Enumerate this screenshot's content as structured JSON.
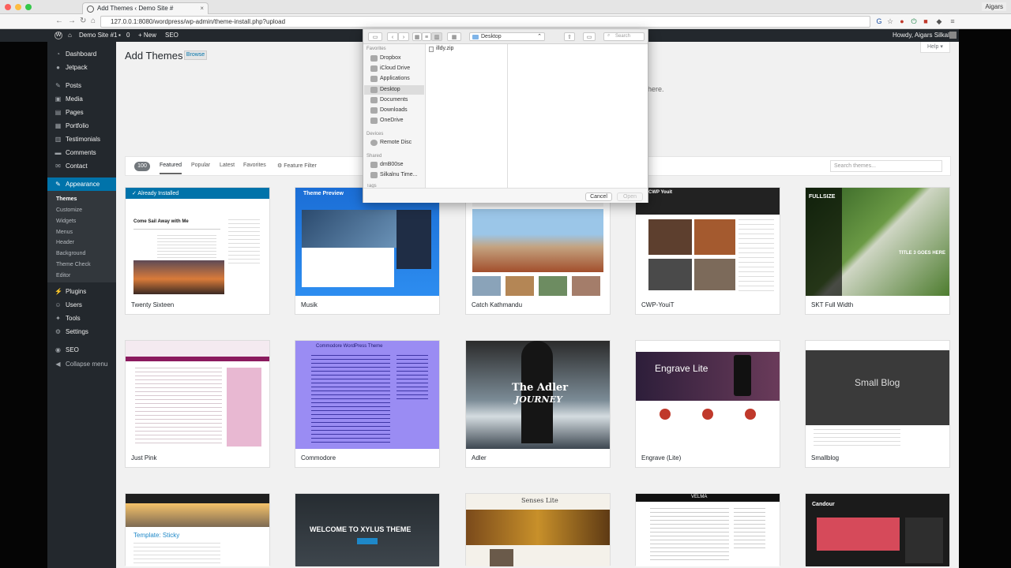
{
  "browser": {
    "tab_title": "Add Themes ‹ Demo Site #",
    "tab_close": "×",
    "profile": "Aigars",
    "url": "127.0.0.1:8080/wordpress/wp-admin/theme-install.php?upload",
    "back_icon": "←",
    "forward_icon": "→",
    "reload_icon": "↻",
    "home_icon": "⌂",
    "star_icon": "☆",
    "menu_icon": "≡"
  },
  "adminbar": {
    "wp_logo": "W",
    "site_name": "Demo Site #1",
    "comments_count": "0",
    "new_label": "+ New",
    "seo_label": "SEO",
    "greeting": "Howdy, Aigars Silkalns"
  },
  "sidebar": {
    "items": [
      {
        "label": "Dashboard"
      },
      {
        "label": "Jetpack"
      },
      {
        "label": "Posts"
      },
      {
        "label": "Media"
      },
      {
        "label": "Pages"
      },
      {
        "label": "Portfolio"
      },
      {
        "label": "Testimonials"
      },
      {
        "label": "Comments"
      },
      {
        "label": "Contact"
      },
      {
        "label": "Appearance"
      }
    ],
    "submenu": [
      "Themes",
      "Customize",
      "Widgets",
      "Menus",
      "Header",
      "Background",
      "Theme Check",
      "Editor"
    ],
    "lower": [
      {
        "label": "Plugins"
      },
      {
        "label": "Users"
      },
      {
        "label": "Tools"
      },
      {
        "label": "Settings"
      },
      {
        "label": "SEO"
      },
      {
        "label": "Collapse menu"
      }
    ]
  },
  "page": {
    "title": "Add Themes",
    "browse_label": "Browse",
    "help_label": "Help ▾",
    "upload_hint_tail": "here."
  },
  "filters": {
    "count": "100",
    "tabs": [
      "Featured",
      "Popular",
      "Latest",
      "Favorites"
    ],
    "feature_filter": "Feature Filter",
    "search_placeholder": "Search themes..."
  },
  "themes": [
    {
      "name": "Twenty Sixteen",
      "installed_label": "✓  Already Installed"
    },
    {
      "name": "Musik"
    },
    {
      "name": "Catch Kathmandu"
    },
    {
      "name": "CWP-YouiT"
    },
    {
      "name": "SKT Full Width"
    },
    {
      "name": "Just Pink"
    },
    {
      "name": "Commodore"
    },
    {
      "name": "Adler"
    },
    {
      "name": "Engrave (Lite)"
    },
    {
      "name": "Smallblog"
    },
    {
      "name": "",
      "shot_text": "Template: Sticky"
    },
    {
      "name": "",
      "shot_text": "WELCOME TO XYLUS THEME"
    },
    {
      "name": "",
      "shot_text": "Senses Lite"
    },
    {
      "name": "",
      "shot_text": "VELMA"
    },
    {
      "name": "",
      "shot_text": "Candour"
    }
  ],
  "shot_texts": {
    "twenty_sixteen": "Come Sail Away with Me",
    "musik": "Theme Preview",
    "adler": "The Adler",
    "adler_sub": "JOURNEY",
    "engrave": "Engrave Lite",
    "smallblog": "Small Blog",
    "skt": "TITLE 3 GOES HERE",
    "skt_logo": "FULLSIZE",
    "commodore": "Commodore WordPress Theme",
    "cwp": "CWP Youit"
  },
  "dialog": {
    "location": "Desktop",
    "search_placeholder": "Search",
    "favorites_heading": "Favorites",
    "favorites": [
      "Dropbox",
      "iCloud Drive",
      "Applications",
      "Desktop",
      "Documents",
      "Downloads",
      "OneDrive"
    ],
    "devices_heading": "Devices",
    "devices": [
      "Remote Disc"
    ],
    "shared_heading": "Shared",
    "shared": [
      "dmB00se",
      "Silkalnu Time..."
    ],
    "tags_heading": "Tags",
    "file": "illdy.zip",
    "cancel_label": "Cancel",
    "open_label": "Open"
  },
  "colors": {
    "admin_bar": "#23282d",
    "accent": "#0073aa",
    "menu_bg": "#23282d"
  }
}
